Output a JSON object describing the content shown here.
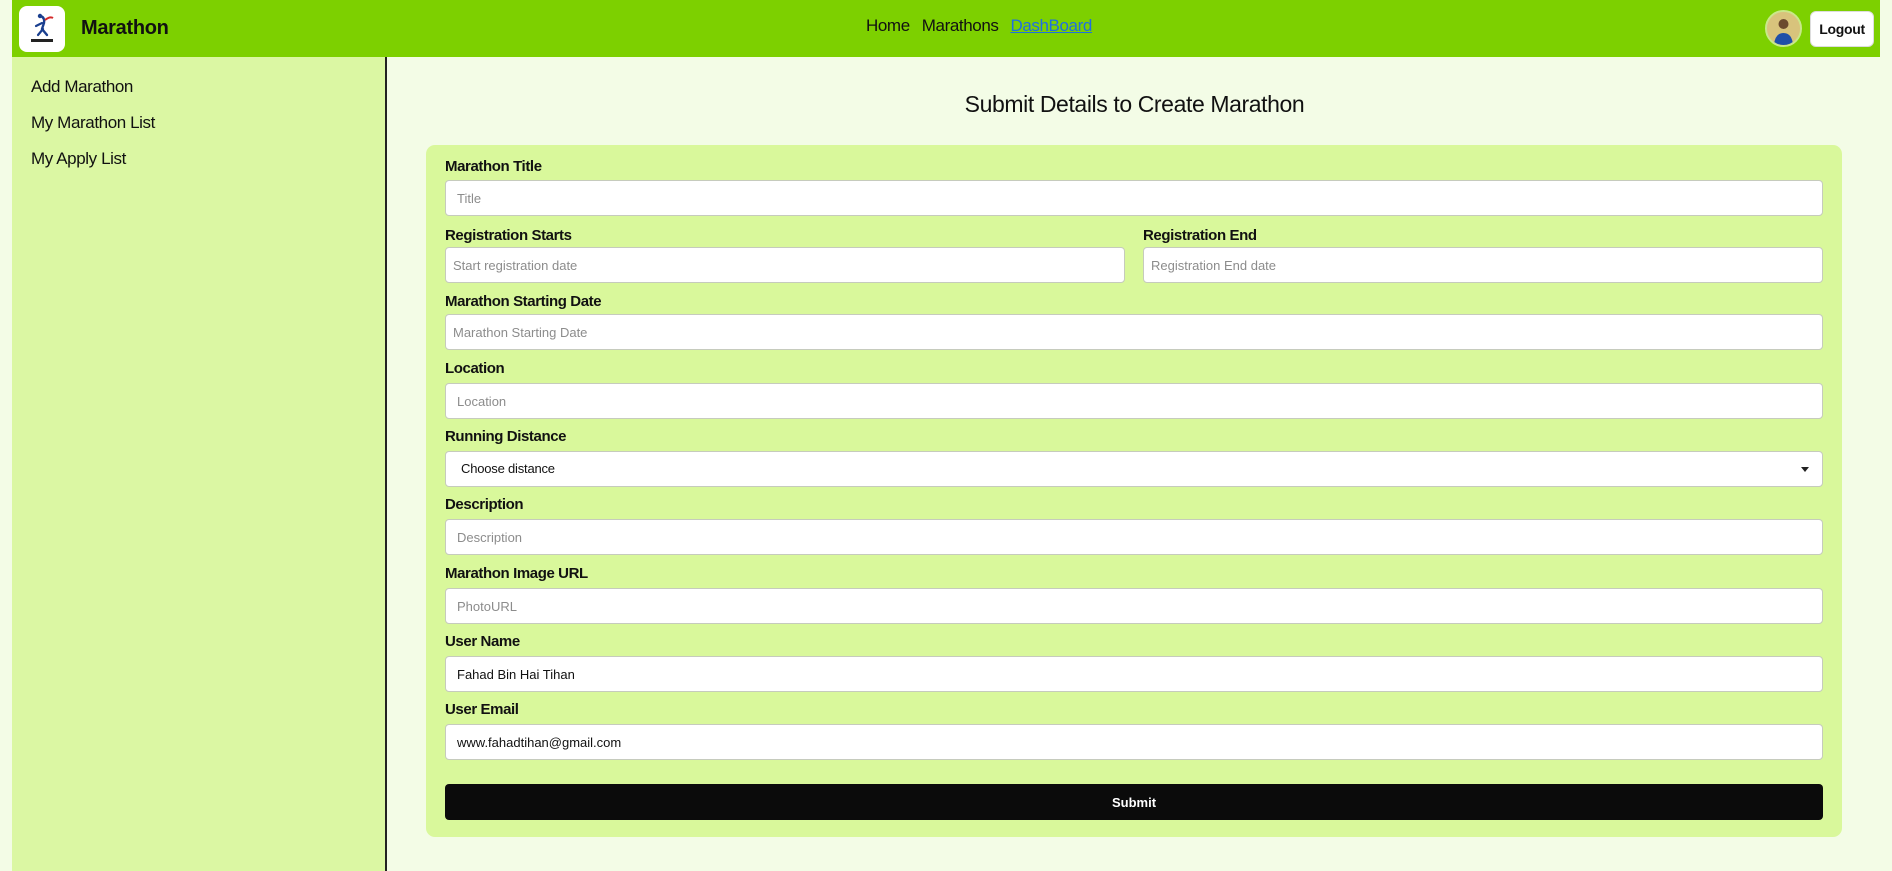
{
  "navbar": {
    "brand": "Marathon",
    "links": [
      {
        "label": "Home",
        "active": false
      },
      {
        "label": "Marathons",
        "active": false
      },
      {
        "label": "DashBoard",
        "active": true
      }
    ],
    "logout_label": "Logout",
    "colors": {
      "background": "#7dd000",
      "active_link": "#1f6fe0"
    }
  },
  "sidebar": {
    "items": [
      {
        "label": "Add Marathon"
      },
      {
        "label": "My Marathon List"
      },
      {
        "label": "My Apply List"
      }
    ]
  },
  "form": {
    "title": "Submit Details to Create Marathon",
    "fields": {
      "title": {
        "label": "Marathon Title",
        "placeholder": "Title",
        "value": ""
      },
      "reg_start": {
        "label": "Registration Starts",
        "placeholder": "Start registration date",
        "value": ""
      },
      "reg_end": {
        "label": "Registration End",
        "placeholder": "Registration End date",
        "value": ""
      },
      "start_date": {
        "label": "Marathon Starting Date",
        "placeholder": "Marathon Starting Date",
        "value": ""
      },
      "location": {
        "label": "Location",
        "placeholder": "Location",
        "value": ""
      },
      "distance": {
        "label": "Running Distance",
        "selected": "Choose distance"
      },
      "description": {
        "label": "Description",
        "placeholder": "Description",
        "value": ""
      },
      "image_url": {
        "label": "Marathon Image URL",
        "placeholder": "PhotoURL",
        "value": ""
      },
      "user_name": {
        "label": "User Name",
        "value": "Fahad Bin Hai Tihan"
      },
      "user_email": {
        "label": "User Email",
        "value": "www.fahadtihan@gmail.com"
      }
    },
    "submit_label": "Submit",
    "colors": {
      "card": "#d9f89b",
      "submit": "#0b0b0b",
      "page_bg": "#f3fce6",
      "sidebar_bg": "#dbf7a3"
    }
  }
}
